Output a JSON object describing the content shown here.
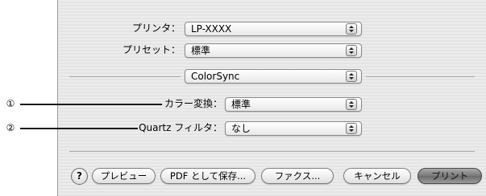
{
  "printer": {
    "label": "プリンタ：",
    "value": "LP-XXXX"
  },
  "preset": {
    "label": "プリセット：",
    "value": "標準"
  },
  "panel": {
    "value": "ColorSync"
  },
  "color_conversion": {
    "label": "カラー変換：",
    "value": "標準"
  },
  "quartz_filter": {
    "label": "Quartz フィルタ：",
    "value": "なし"
  },
  "callouts": {
    "one": "①",
    "two": "②"
  },
  "buttons": {
    "help": "?",
    "preview": "プレビュー",
    "save_pdf": "PDF として保存...",
    "fax": "ファクス...",
    "cancel": "キャンセル",
    "print": "プリント"
  },
  "icons": {
    "popup_arrows": "updown-chevron-icon",
    "help": "question-icon"
  }
}
